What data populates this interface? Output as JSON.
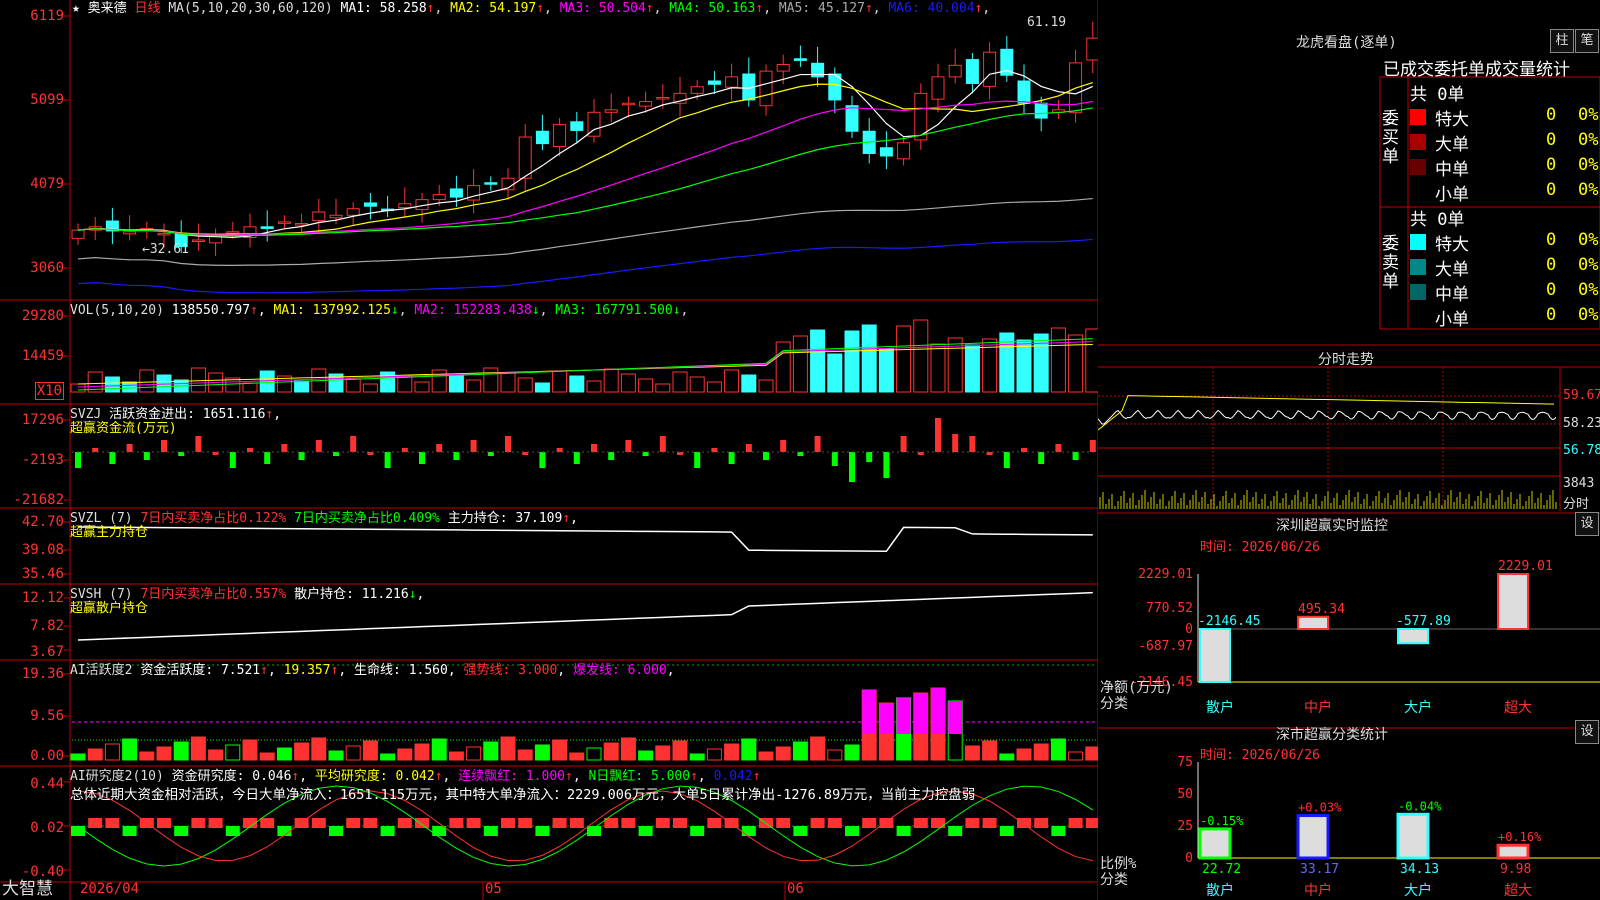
{
  "colors": {
    "up": "#ff3232",
    "down": "#32ffff",
    "green": "#00ff00",
    "yellow": "#ffff00",
    "magenta": "#ff00ff",
    "grid": "#c00000",
    "blue": "#1a1aff",
    "gray": "#aaaaaa"
  },
  "main_panel": {
    "star": "★",
    "name": "奥来德",
    "period": "日线",
    "ma_title": "MA(5,10,20,30,60,120)",
    "ma": [
      {
        "label": "MA1:",
        "value": "58.258",
        "arrow": "↑",
        "color": "#ffffff"
      },
      {
        "label": "MA2:",
        "value": "54.197",
        "arrow": "↑",
        "color": "#ffff00"
      },
      {
        "label": "MA3:",
        "value": "50.504",
        "arrow": "↑",
        "color": "#ff00ff"
      },
      {
        "label": "MA4:",
        "value": "50.163",
        "arrow": "↑",
        "color": "#00ff00"
      },
      {
        "label": "MA5:",
        "value": "45.127",
        "arrow": "↑",
        "color": "#aaaaaa"
      },
      {
        "label": "MA6:",
        "value": "40.004",
        "arrow": "↑",
        "color": "#1a1aff"
      }
    ],
    "axis": [
      "6119",
      "5099",
      "4079",
      "3060"
    ],
    "high_label": "61.19",
    "low_label": "←32.61"
  },
  "vol_panel": {
    "title": "VOL(5,10,20)",
    "value": "138550.797",
    "arrow": "↑",
    "mas": [
      {
        "label": "MA1:",
        "value": "137992.125",
        "arrow": "↓",
        "color": "#ffff00"
      },
      {
        "label": "MA2:",
        "value": "152283.438",
        "arrow": "↓",
        "color": "#ff00ff"
      },
      {
        "label": "MA3:",
        "value": "167791.500",
        "arrow": "↓",
        "color": "#00ff00"
      }
    ],
    "axis": [
      "29280",
      "14459"
    ],
    "unit": "X10"
  },
  "svzj_panel": {
    "title": "SVZJ",
    "label": "活跃资金进出:",
    "value": "1651.116",
    "arrow": "↑",
    "subtitle": "超赢资金流(万元)",
    "axis": [
      "17296",
      "-2193",
      "-21682"
    ]
  },
  "svzl_panel": {
    "title": "SVZL (7)",
    "t1": "7日内买卖净占比0.122%",
    "t2": "7日内买卖净占比0.409%",
    "t3": "主力持仓: 37.109",
    "arrow": "↑",
    "subtitle": "超赢主力持仓",
    "axis": [
      "42.70",
      "39.08",
      "35.46"
    ]
  },
  "svsh_panel": {
    "title": "SVSH (7)",
    "t1": "7日内买卖净占比0.557%",
    "t2": "散户持仓: 11.216",
    "arrow": "↓",
    "subtitle": "超赢散户持仓",
    "axis": [
      "12.12",
      "7.82",
      "3.67"
    ]
  },
  "ai_active": {
    "title": "AI活跃度2",
    "t1": "资金活跃度: 7.521",
    "t2": "19.357",
    "t3": "生命线: 1.560",
    "t4": "强势线: 3.000",
    "t5": "爆发线: 6.000",
    "axis": [
      "19.36",
      "9.56",
      "0.00"
    ]
  },
  "ai_research": {
    "title": "AI研究度2(10)",
    "t1": "资金研究度: 0.046",
    "t2": "平均研究度: 0.042",
    "t3": "连续飘红: 1.000",
    "t4": "N日飘红: 5.000",
    "t5": "0.042",
    "summary": "总体近期大资金相对活跃，今日大单净流入：1651.115万元，其中特大单净流入：2229.006万元，大单5日累计净出-1276.89万元，当前主力控盘弱",
    "axis": [
      "0.44",
      "0.02",
      "-0.40"
    ]
  },
  "bottom_bar": {
    "brand": "大智慧",
    "dates": [
      "2026/04",
      "05",
      "06"
    ]
  },
  "right": {
    "dragon_title": "龙虎看盘(逐单)",
    "btn_bar": "柱",
    "btn_pen": "笔",
    "tabs": [
      "已成交",
      "委托单",
      "成交量统计"
    ],
    "buy_group": {
      "label": "委买单",
      "total": "共 0单",
      "rows": [
        {
          "name": "特大",
          "count": "0",
          "pct": "0%",
          "color": "#ff0000"
        },
        {
          "name": "大单",
          "count": "0",
          "pct": "0%",
          "color": "#aa0000"
        },
        {
          "name": "中单",
          "count": "0",
          "pct": "0%",
          "color": "#660000"
        },
        {
          "name": "小单",
          "count": "0",
          "pct": "0%",
          "color": "#000000"
        }
      ]
    },
    "sell_group": {
      "label": "委卖单",
      "total": "共 0单",
      "rows": [
        {
          "name": "特大",
          "count": "0",
          "pct": "0%",
          "color": "#00ffff"
        },
        {
          "name": "大单",
          "count": "0",
          "pct": "0%",
          "color": "#008888"
        },
        {
          "name": "中单",
          "count": "0",
          "pct": "0%",
          "color": "#006666"
        },
        {
          "name": "小单",
          "count": "0",
          "pct": "0%",
          "color": "#000000"
        }
      ]
    },
    "intraday": {
      "title": "分时走势",
      "axis": [
        "59.67",
        "58.23",
        "56.78"
      ],
      "vol_axis": [
        "3843",
        "分时"
      ]
    },
    "monitor": {
      "title": "深圳超赢实时监控",
      "btn": "设",
      "time": "时间: 2026/06/26",
      "axis": [
        "2229.01",
        "770.52",
        "0",
        "-687.97",
        "-2146.45"
      ],
      "ylabel": [
        "净额(万元)",
        "分类"
      ],
      "cats": [
        "散户",
        "中户",
        "大户",
        "超大"
      ],
      "values": [
        -2146.45,
        495.34,
        -577.89,
        2229.01
      ],
      "labels": [
        "-2146.45",
        "495.34",
        "-577.89",
        "2229.01"
      ]
    },
    "classify": {
      "title": "深市超赢分类统计",
      "btn": "设",
      "time": "时间: 2026/06/26",
      "axis": [
        "75",
        "50",
        "25",
        "0"
      ],
      "ylabel": [
        "比例%",
        "分类"
      ],
      "cats": [
        "散户",
        "中户",
        "大户",
        "超大"
      ],
      "values": [
        22.72,
        33.17,
        34.13,
        9.98
      ],
      "top_labels": [
        "-0.15%",
        "+0.03%",
        "-0.04%",
        "+0.16%"
      ],
      "bottom_labels": [
        "22.72",
        "33.17",
        "34.13",
        "9.98"
      ]
    }
  }
}
